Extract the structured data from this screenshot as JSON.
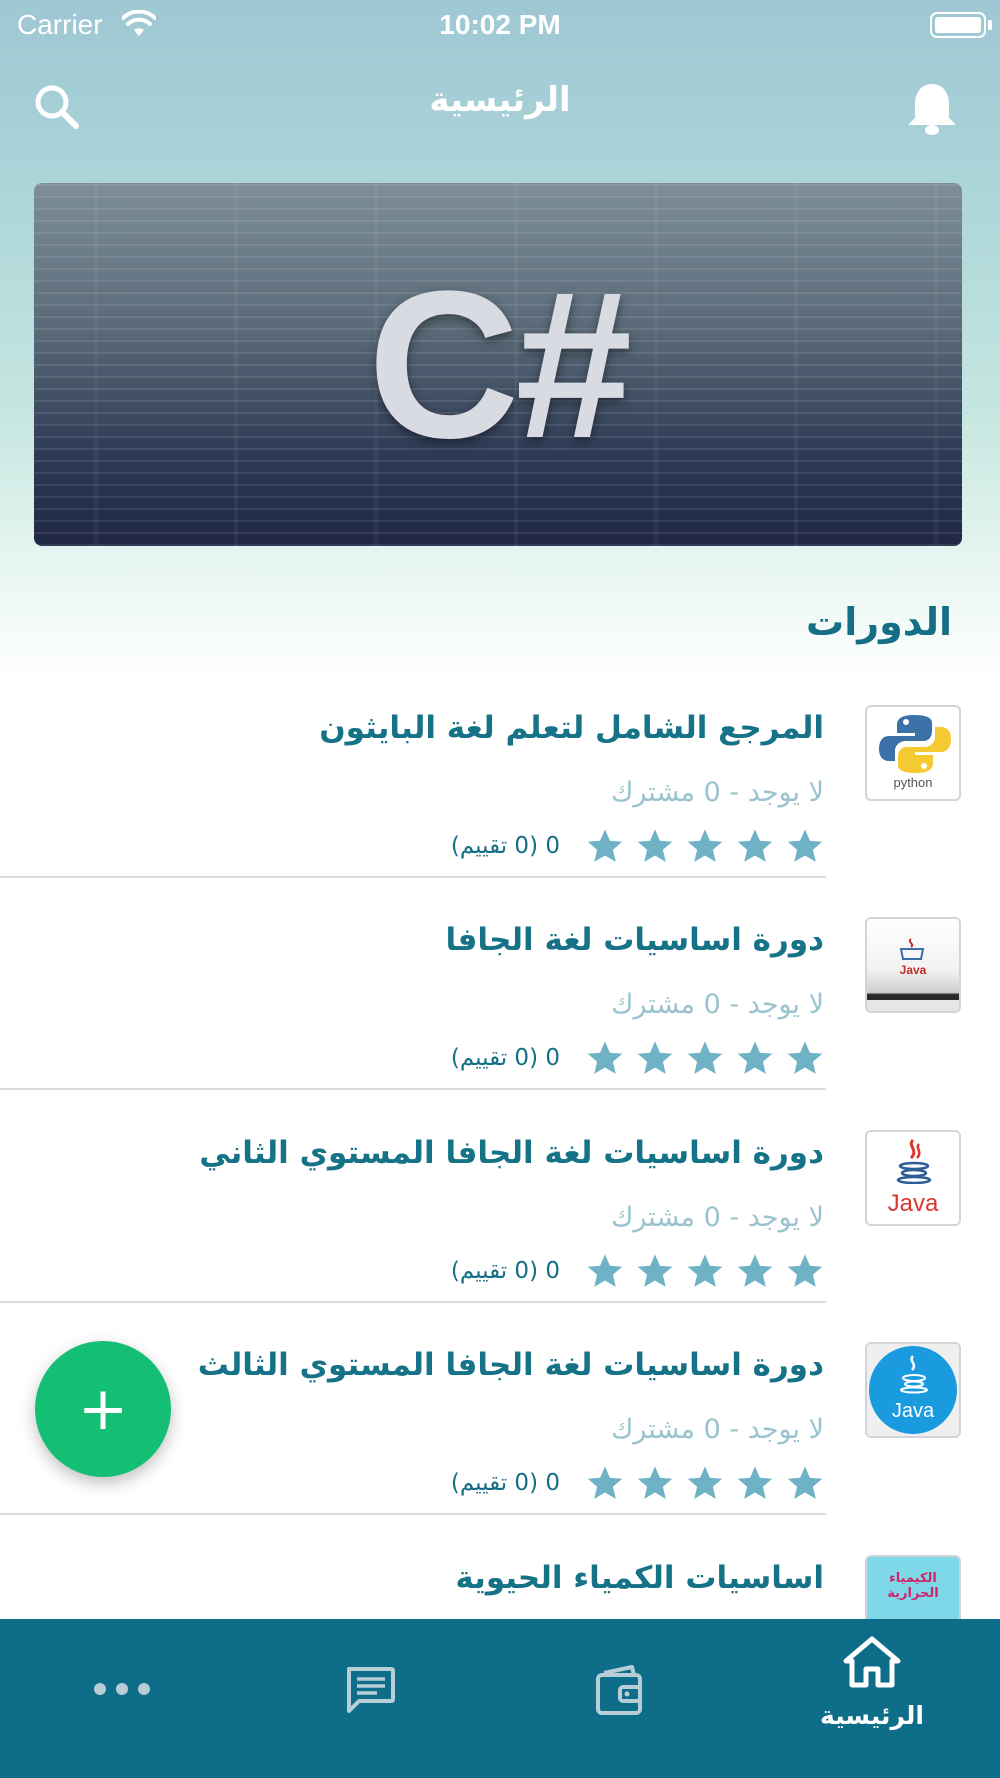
{
  "status_bar": {
    "carrier": "Carrier",
    "time": "10:02 PM"
  },
  "header": {
    "title": "الرئيسية",
    "search_icon": "search-icon",
    "notification_icon": "bell-icon"
  },
  "banner": {
    "text": "C#"
  },
  "section": {
    "title": "الدورات"
  },
  "courses": [
    {
      "title": "المرجع الشامل لتعلم لغة البايثون",
      "subtitle": "لا يوجد - 0 مشترك",
      "rating_text": "0 (0 تقييم)",
      "rating_value": 0,
      "thumbnail": "python-logo",
      "thumb_label": "python"
    },
    {
      "title": "دورة اساسيات لغة الجافا",
      "subtitle": "لا يوجد - 0 مشترك",
      "rating_text": "0 (0 تقييم)",
      "rating_value": 0,
      "thumbnail": "java-book-cover",
      "thumb_label": "Java"
    },
    {
      "title": "دورة اساسيات لغة الجافا المستوي الثاني",
      "subtitle": "لا يوجد - 0 مشترك",
      "rating_text": "0 (0 تقييم)",
      "rating_value": 0,
      "thumbnail": "java-logo",
      "thumb_label": "Java"
    },
    {
      "title": "دورة اساسيات لغة الجافا المستوي الثالث",
      "subtitle": "لا يوجد - 0 مشترك",
      "rating_text": "0 (0 تقييم)",
      "rating_value": 0,
      "thumbnail": "java-blue-logo",
      "thumb_label": "Java"
    },
    {
      "title": "اساسيات الكمياء الحيوية",
      "thumbnail": "chemistry-cover",
      "thumb_label": "الكيمياء الحرارية"
    }
  ],
  "fab": {
    "label": "+",
    "color": "#14bf74"
  },
  "tabbar": {
    "background": "#0e6d88",
    "items": [
      {
        "label": "الرئيسية",
        "icon": "home-icon",
        "active": true
      },
      {
        "label": "",
        "icon": "wallet-icon",
        "active": false
      },
      {
        "label": "",
        "icon": "chat-icon",
        "active": false
      },
      {
        "label": "",
        "icon": "more-icon",
        "active": false
      }
    ]
  },
  "colors": {
    "accent": "#146e86",
    "muted": "#9ac3cf",
    "star": "#6fb2c6"
  }
}
